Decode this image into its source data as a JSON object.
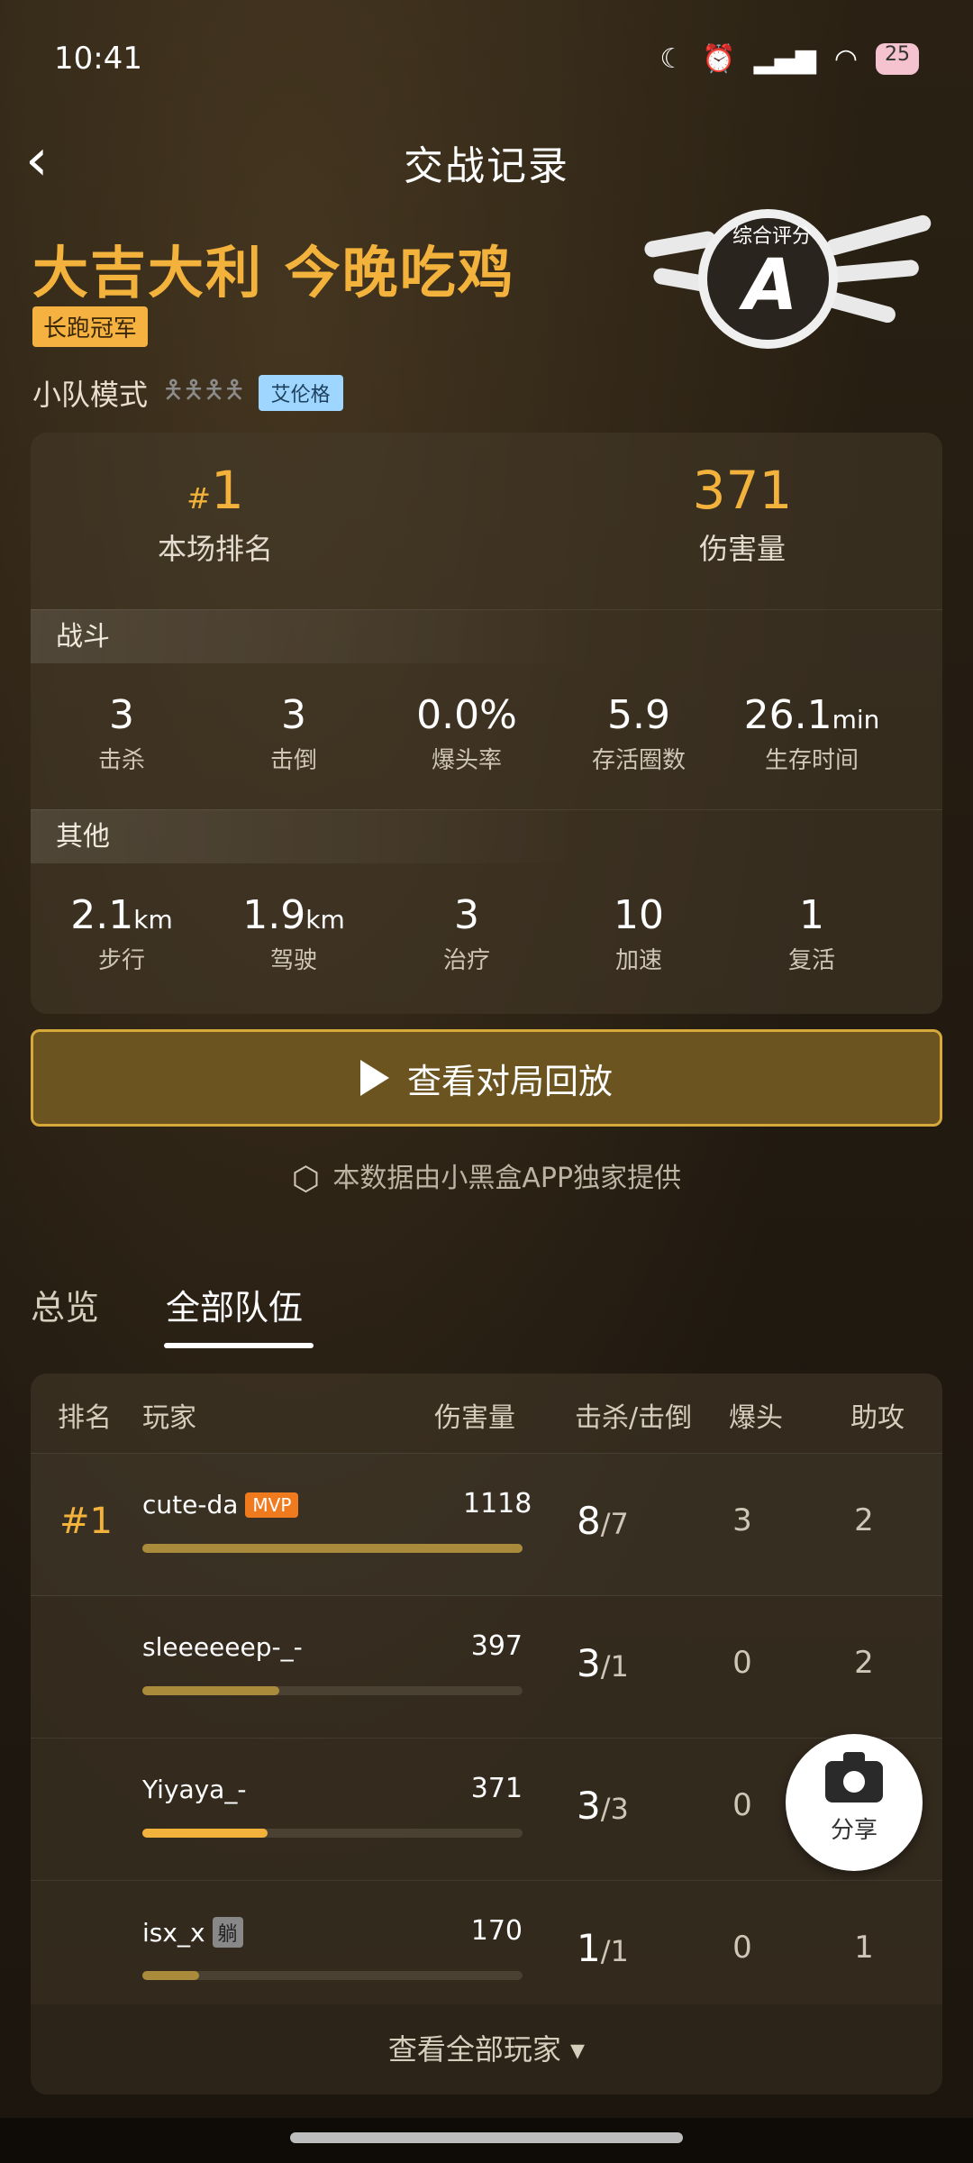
{
  "status": {
    "time": "10:41",
    "battery": "25"
  },
  "header": {
    "title": "交战记录"
  },
  "banner": {
    "win_title": "大吉大利 今晚吃鸡",
    "champ_tag": "长跑冠军",
    "mode": "小队模式",
    "map": "艾伦格",
    "rating_label": "综合评分",
    "rating_grade": "A"
  },
  "summary": {
    "rank_hash": "#",
    "rank_value": "1",
    "rank_label": "本场排名",
    "damage_value": "371",
    "damage_label": "伤害量"
  },
  "combat": {
    "section": "战斗",
    "stats": [
      {
        "value": "3",
        "unit": "",
        "label": "击杀"
      },
      {
        "value": "3",
        "unit": "",
        "label": "击倒"
      },
      {
        "value": "0.0%",
        "unit": "",
        "label": "爆头率"
      },
      {
        "value": "5.9",
        "unit": "",
        "label": "存活圈数"
      },
      {
        "value": "26.1",
        "unit": "min",
        "label": "生存时间"
      }
    ]
  },
  "other": {
    "section": "其他",
    "stats": [
      {
        "value": "2.1",
        "unit": "km",
        "label": "步行"
      },
      {
        "value": "1.9",
        "unit": "km",
        "label": "驾驶"
      },
      {
        "value": "3",
        "unit": "",
        "label": "治疗"
      },
      {
        "value": "10",
        "unit": "",
        "label": "加速"
      },
      {
        "value": "1",
        "unit": "",
        "label": "复活"
      }
    ]
  },
  "replay_label": "查看对局回放",
  "source_text": "本数据由小黑盒APP独家提供",
  "tabs": [
    "总览",
    "全部队伍"
  ],
  "table": {
    "headers": [
      "排名",
      "玩家",
      "伤害量",
      "击杀/击倒",
      "爆头",
      "助攻"
    ],
    "rows": [
      {
        "rank": "#1",
        "name": "cute-da",
        "badge": "MVP",
        "damage": "1118",
        "bar": 1.0,
        "kills": "8",
        "downs": "7",
        "hs": "3",
        "assist": "2"
      },
      {
        "rank": "",
        "name": "sleeeeeep-_-",
        "badge": "",
        "damage": "397",
        "bar": 0.36,
        "kills": "3",
        "downs": "1",
        "hs": "0",
        "assist": "2"
      },
      {
        "rank": "",
        "name": "Yiyaya_-",
        "badge": "",
        "damage": "371",
        "bar": 0.33,
        "kills": "3",
        "downs": "3",
        "hs": "0",
        "assist": ""
      },
      {
        "rank": "",
        "name": "isx_x",
        "badge": "躺",
        "damage": "170",
        "bar": 0.15,
        "kills": "1",
        "downs": "1",
        "hs": "0",
        "assist": "1"
      }
    ],
    "see_all": "查看全部玩家 ▾"
  },
  "share_label": "分享"
}
